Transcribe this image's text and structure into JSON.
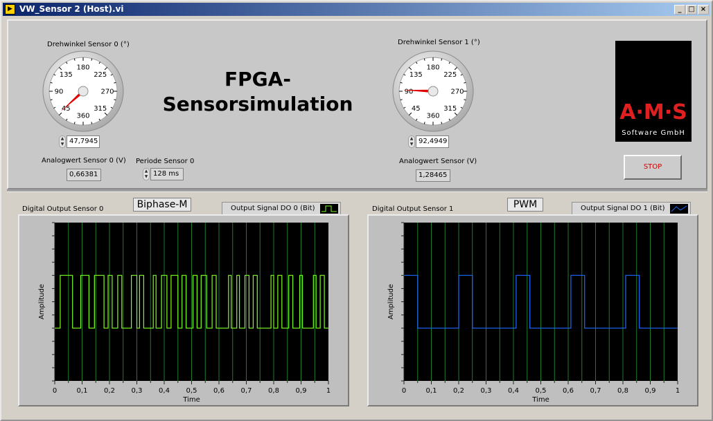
{
  "window": {
    "title": "VW_Sensor 2 (Host).vi",
    "min": "_",
    "max": "□",
    "close": "×"
  },
  "heading": {
    "line1": "FPGA-",
    "line2": "Sensorsimulation"
  },
  "gauge0": {
    "label": "Drehwinkel Sensor 0 (°)",
    "value_text": "47,7945",
    "value": 47.7945,
    "ticks": [
      "360",
      "45",
      "90",
      "135",
      "180",
      "225",
      "270",
      "315"
    ]
  },
  "gauge1": {
    "label": "Drehwinkel Sensor 1 (°)",
    "value_text": "92,4949",
    "value": 92.4949,
    "ticks": [
      "360",
      "45",
      "90",
      "135",
      "180",
      "225",
      "270",
      "315"
    ]
  },
  "analog0": {
    "label": "Analogwert Sensor 0 (V)",
    "value": "0,66381"
  },
  "analog1": {
    "label": "Analogwert Sensor (V)",
    "value": "1,28465"
  },
  "period0": {
    "label": "Periode Sensor 0",
    "value": "128 ms"
  },
  "logo": {
    "brand": "A·M·S",
    "sub": "Software GmbH",
    "brand_color": "#e02020"
  },
  "stop": {
    "label": "STOP",
    "color": "#d00000"
  },
  "graph0": {
    "title": "Digital Output Sensor 0",
    "mode": "Biphase-M",
    "legend": "Output Signal DO 0 (Bit)",
    "ylabel": "Amplitude",
    "xlabel": "Time",
    "color": "#7cff20"
  },
  "graph1": {
    "title": "Digital Output Sensor 1",
    "mode": "PWM",
    "legend": "Output Signal DO 1 (Bit)",
    "ylabel": "Amplitude",
    "xlabel": "Time",
    "color": "#1e6aff"
  },
  "chart_data": [
    {
      "type": "line",
      "series": [
        {
          "name": "Output Signal DO 0 (Bit)",
          "steps": [
            [
              0,
              0
            ],
            [
              0.02,
              1
            ],
            [
              0.065,
              0
            ],
            [
              0.095,
              1
            ],
            [
              0.125,
              0
            ],
            [
              0.145,
              1
            ],
            [
              0.18,
              0
            ],
            [
              0.195,
              1
            ],
            [
              0.21,
              0
            ],
            [
              0.23,
              1
            ],
            [
              0.245,
              0
            ],
            [
              0.28,
              1
            ],
            [
              0.3,
              0
            ],
            [
              0.31,
              1
            ],
            [
              0.325,
              0
            ],
            [
              0.36,
              1
            ],
            [
              0.37,
              0
            ],
            [
              0.39,
              1
            ],
            [
              0.41,
              0
            ],
            [
              0.425,
              1
            ],
            [
              0.45,
              0
            ],
            [
              0.465,
              1
            ],
            [
              0.48,
              0
            ],
            [
              0.505,
              1
            ],
            [
              0.52,
              0
            ],
            [
              0.535,
              1
            ],
            [
              0.555,
              0
            ],
            [
              0.575,
              1
            ],
            [
              0.59,
              0
            ],
            [
              0.635,
              1
            ],
            [
              0.645,
              0
            ],
            [
              0.665,
              1
            ],
            [
              0.675,
              0
            ],
            [
              0.695,
              1
            ],
            [
              0.71,
              0
            ],
            [
              0.725,
              1
            ],
            [
              0.74,
              0
            ],
            [
              0.79,
              1
            ],
            [
              0.8,
              0
            ],
            [
              0.815,
              1
            ],
            [
              0.83,
              0
            ],
            [
              0.855,
              1
            ],
            [
              0.87,
              0
            ],
            [
              0.895,
              1
            ],
            [
              0.905,
              0
            ],
            [
              0.945,
              1
            ],
            [
              0.955,
              0
            ],
            [
              0.97,
              1
            ],
            [
              0.985,
              0
            ],
            [
              1,
              0
            ]
          ]
        }
      ],
      "xlabel": "Time",
      "ylabel": "Amplitude",
      "xlim": [
        0,
        1
      ],
      "ylim": [
        -1,
        2
      ],
      "xticks": [
        "0",
        "0,1",
        "0,2",
        "0,3",
        "0,4",
        "0,5",
        "0,6",
        "0,7",
        "0,8",
        "0,9",
        "1"
      ],
      "grid": true
    },
    {
      "type": "line",
      "series": [
        {
          "name": "Output Signal DO 1 (Bit)",
          "steps": [
            [
              0,
              1
            ],
            [
              0.05,
              0
            ],
            [
              0.2,
              1
            ],
            [
              0.25,
              0
            ],
            [
              0.41,
              1
            ],
            [
              0.46,
              0
            ],
            [
              0.61,
              1
            ],
            [
              0.66,
              0
            ],
            [
              0.81,
              1
            ],
            [
              0.86,
              0
            ],
            [
              1,
              0
            ]
          ]
        }
      ],
      "xlabel": "Time",
      "ylabel": "Amplitude",
      "xlim": [
        0,
        1
      ],
      "ylim": [
        -1,
        2
      ],
      "xticks": [
        "0",
        "0,1",
        "0,2",
        "0,3",
        "0,4",
        "0,5",
        "0,6",
        "0,7",
        "0,8",
        "0,9",
        "1"
      ],
      "grid": true
    }
  ]
}
